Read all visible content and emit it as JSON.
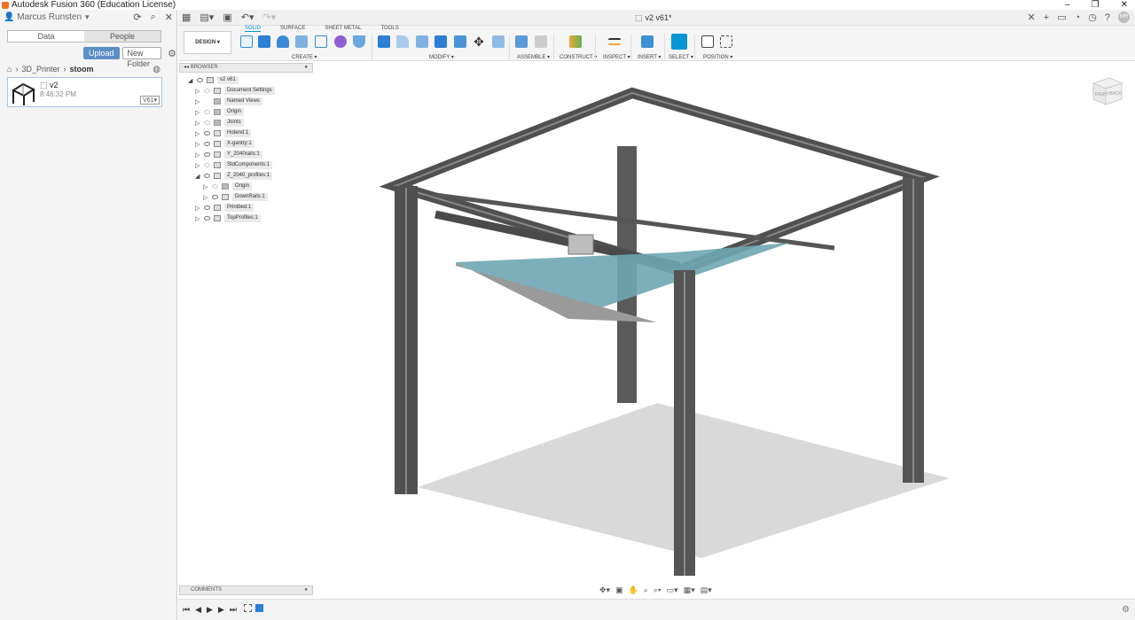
{
  "window": {
    "title": "Autodesk Fusion 360 (Education License)",
    "controls": [
      "–",
      "❐",
      "✕"
    ]
  },
  "data_panel": {
    "user": "Marcus Runsten",
    "tabs": [
      "Data",
      "People"
    ],
    "upload_label": "Upload",
    "new_folder_label": "New Folder",
    "breadcrumb": [
      "3D_Printer",
      "stoom"
    ],
    "file": {
      "name": "v2",
      "time": "8:46:32 PM",
      "version": "V61▾"
    }
  },
  "appbar": {
    "doc_title": "v2 v61*"
  },
  "ribbon": {
    "workspace": "DESIGN ▾",
    "tabs": [
      "SOLID",
      "SURFACE",
      "SHEET METAL",
      "TOOLS"
    ],
    "groups": [
      "CREATE ▾",
      "MODIFY ▾",
      "ASSEMBLE ▾",
      "CONSTRUCT ▾",
      "INSPECT ▾",
      "INSERT ▾",
      "SELECT ▾",
      "POSITION ▾"
    ]
  },
  "browser": {
    "title": "BROWSER",
    "nodes": [
      "v2 v61",
      "Document Settings",
      "Named Views",
      "Origin",
      "Joints",
      "Hotend:1",
      "X-gantry:1",
      "Y_2040rails:1",
      "StdComponents:1",
      "Z_2040_profiles:1",
      "Origin",
      "DownRails:1",
      "Printbed:1",
      "TopProfiles:1"
    ]
  },
  "comments_title": "COMMENTS",
  "viewcube": {
    "right": "RIGHT",
    "back": "BACK"
  },
  "colors": {
    "accent": "#0696d7",
    "upload": "#5b8fc7",
    "frame": "#5a5a5a",
    "bed": "#6fa6b3"
  }
}
